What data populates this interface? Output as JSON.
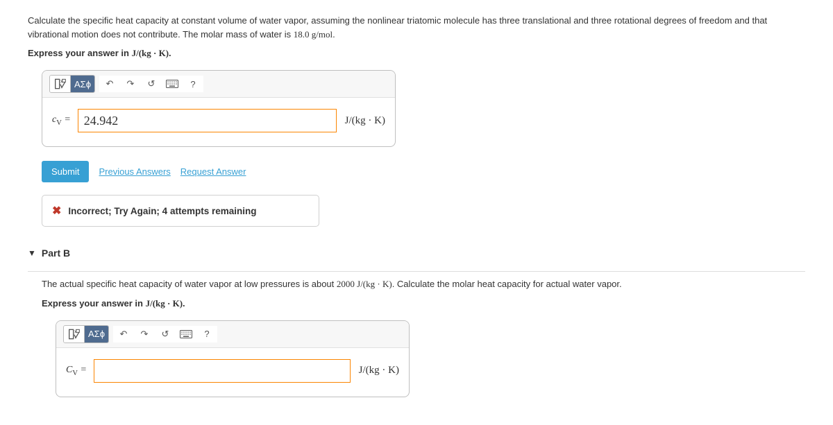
{
  "partA": {
    "question": "Calculate the specific heat capacity at constant volume of water vapor, assuming the nonlinear triatomic molecule has three translational and three rotational degrees of freedom and that vibrational motion does not contribute. The molar mass of water is ",
    "molar_mass": "18.0 g/mol",
    "question_end": ".",
    "instruction_prefix": "Express your answer in ",
    "instruction_unit": "J/(kg · K)",
    "instruction_suffix": ".",
    "lhs_symbol": "c",
    "lhs_sub": "V",
    "equals": " = ",
    "input_value": "24.942",
    "unit": "J/(kg · K)",
    "submit": "Submit",
    "prev_answers": "Previous Answers",
    "request_answer": "Request Answer",
    "feedback": "Incorrect; Try Again; 4 attempts remaining"
  },
  "partB": {
    "header": "Part B",
    "question": "The actual specific heat capacity of water vapor at low pressures is about ",
    "given_value": "2000 J/(kg · K)",
    "question_end": ". Calculate the molar heat capacity for actual water vapor.",
    "instruction_prefix": "Express your answer in ",
    "instruction_unit": "J/(kg · K)",
    "instruction_suffix": ".",
    "lhs_symbol": "C",
    "lhs_sub": "V",
    "equals": " = ",
    "input_value": "",
    "unit": "J/(kg · K)"
  },
  "toolbar": {
    "templates": "▯√▯",
    "symbols": "ΑΣϕ",
    "undo": "↶",
    "redo": "↷",
    "reset": "↺",
    "keyboard": "⌨",
    "help": "?"
  }
}
